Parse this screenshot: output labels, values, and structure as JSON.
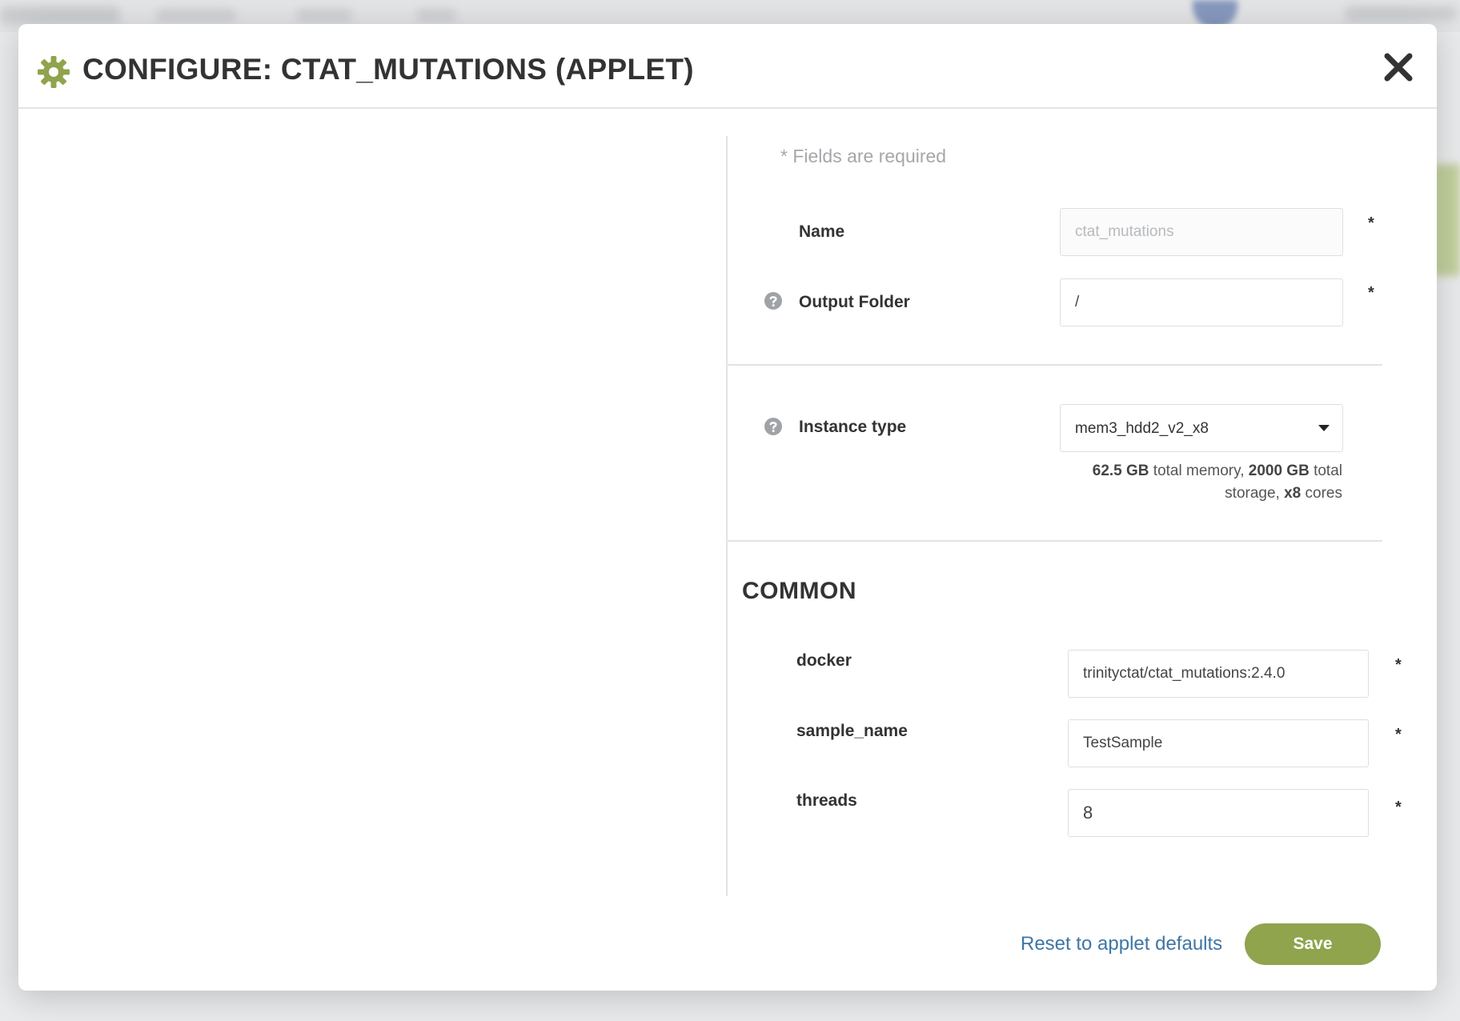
{
  "modal": {
    "title": "CONFIGURE: CTAT_MUTATIONS (APPLET)",
    "accent_color": "#8fa44d",
    "required_note": "* Fields are required",
    "fields": {
      "name": {
        "label": "Name",
        "value": "ctat_mutations",
        "required": "*"
      },
      "output_folder": {
        "label": "Output Folder",
        "value": "/",
        "required": "*"
      },
      "instance_type": {
        "label": "Instance type",
        "value": "mem3_hdd2_v2_x8",
        "memory": "62.5 GB",
        "memory_suffix": " total memory, ",
        "storage": "2000 GB",
        "storage_suffix": " total storage, ",
        "cores": "x8",
        "cores_suffix": " cores"
      }
    },
    "section": {
      "title": "COMMON",
      "fields": [
        {
          "label": "docker",
          "value": "trinityctat/ctat_mutations:2.4.0",
          "required": "*"
        },
        {
          "label": "sample_name",
          "value": "TestSample",
          "required": "*"
        },
        {
          "label": "threads",
          "value": "8",
          "required": "*"
        }
      ]
    },
    "footer": {
      "reset_label": "Reset to applet defaults",
      "save_label": "Save"
    }
  }
}
